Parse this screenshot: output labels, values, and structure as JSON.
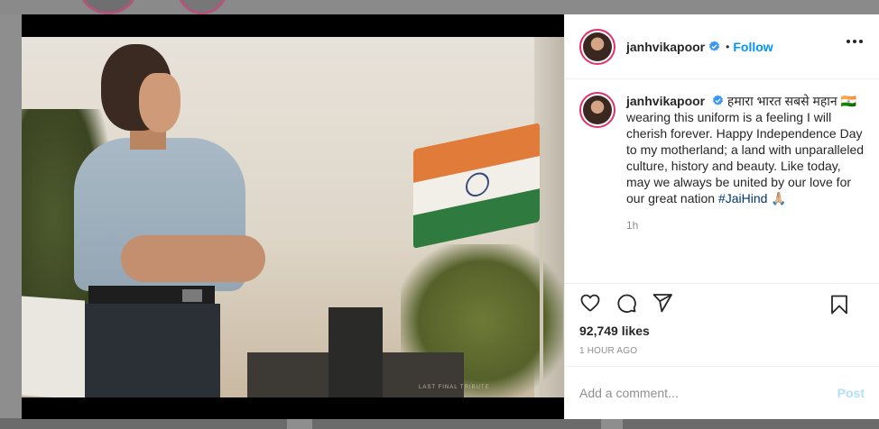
{
  "post": {
    "username": "janhvikapoor",
    "follow_label": "Follow",
    "separator": "•",
    "caption_text_devanagari": "हमारा भारत सबसे महान",
    "caption_flag_emoji": "🇮🇳",
    "caption_text": "wearing this uniform is a feeling I will cherish forever. Happy Independence Day to my motherland; a land with unparalleled culture, history and beauty. Like today, may we always be united by our love for our great nation",
    "caption_hashtag": "#JaiHind",
    "caption_end_emoji": "🙏🏼",
    "comment_time": "1h",
    "likes": "92,749 likes",
    "posted_time": "1 HOUR AGO",
    "comment_placeholder": "Add a comment...",
    "post_button_label": "Post"
  },
  "photo": {
    "plaque_text": "LAST FINAL TRIBUTE"
  },
  "colors": {
    "accent_blue": "#0095f6",
    "verified_blue": "#3897f0",
    "avatar_ring": "#e1306c",
    "post_disabled": "#b2dffc"
  },
  "icons": [
    "verified-badge-icon",
    "more-options-icon",
    "heart-icon",
    "comment-icon",
    "share-icon",
    "bookmark-icon"
  ]
}
